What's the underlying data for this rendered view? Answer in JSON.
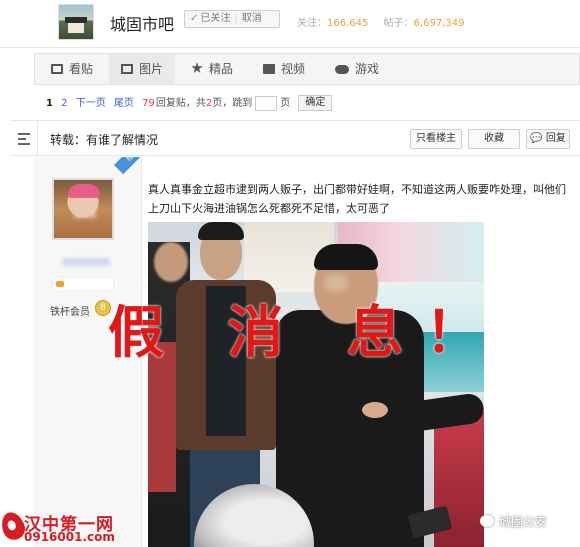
{
  "header": {
    "forum_name": "城固市吧",
    "follow_label": "已关注",
    "cancel_label": "取消",
    "followers_label": "关注：",
    "followers_count": "166,645",
    "posts_label": "帖子：",
    "posts_count": "6,697,349"
  },
  "tabs": [
    {
      "label": "看贴",
      "icon": "doc-icon"
    },
    {
      "label": "图片",
      "icon": "picture-icon"
    },
    {
      "label": "精品",
      "icon": "star-icon"
    },
    {
      "label": "视频",
      "icon": "video-icon"
    },
    {
      "label": "游戏",
      "icon": "gamepad-icon"
    }
  ],
  "pager": {
    "page1": "1",
    "page2": "2",
    "next": "下一页",
    "last": "尾页",
    "reply_count": "79",
    "reply_label": "回复贴，共",
    "total_pages": "2",
    "pages_label": "页，跳到",
    "page_unit": "页",
    "confirm": "确定"
  },
  "title_bar": {
    "title": "转载：有谁了解情况",
    "only_owner": "只看楼主",
    "collect": "收藏",
    "reply": "回复"
  },
  "post": {
    "owner_ribbon": "楼主",
    "member_label": "铁杆会员",
    "level_badge": "8",
    "text": "真人真事金立超市逮到两人贩子，出门都带好娃啊，不知道这两人贩要咋处理，叫他们上刀山下火海进油锅怎么死都死不足惜，太可恶了"
  },
  "overlay": {
    "fake_news": "假 消 息！"
  },
  "watermarks": {
    "left_title": "汉中第一网",
    "left_url": "0916001.com",
    "right_label": "城固公安"
  },
  "colors": {
    "accent_red": "#e01818",
    "link_blue": "#3a5fcd",
    "stat_orange": "#e6a23c"
  }
}
